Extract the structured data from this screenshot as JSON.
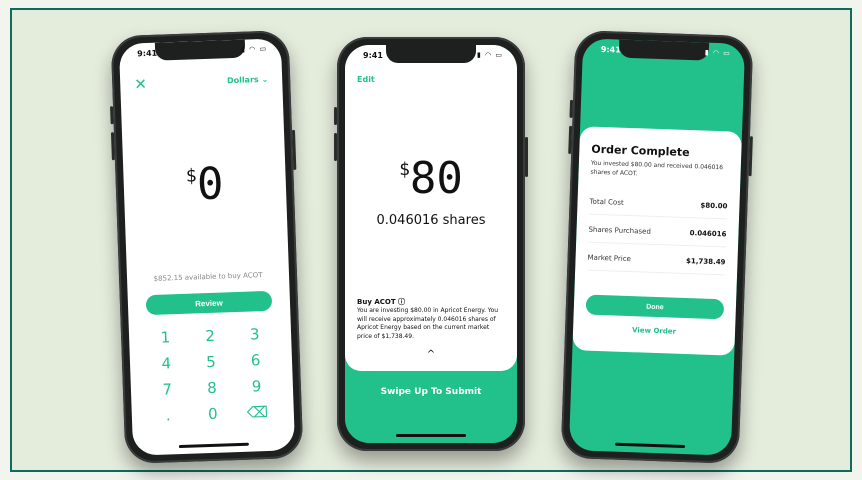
{
  "colors": {
    "accent": "#22c08a",
    "frame_border": "#0f6b60",
    "background": "#e4ecdc"
  },
  "status": {
    "time": "9:41"
  },
  "phone1": {
    "close_icon": "close-icon",
    "currency": "Dollars ⌄",
    "amount_symbol": "$",
    "amount": "0",
    "available": "$852.15 available to buy ACOT",
    "review_label": "Review",
    "keys": [
      "1",
      "2",
      "3",
      "4",
      "5",
      "6",
      "7",
      "8",
      "9",
      ".",
      "0",
      "⌫"
    ]
  },
  "phone2": {
    "edit_label": "Edit",
    "amount_symbol": "$",
    "amount": "80",
    "shares": "0.046016 shares",
    "buy_title": "Buy ACOT ⓘ",
    "buy_desc": "You are investing $80.00 in Apricot Energy. You will receive approximately 0.046016 shares of Apricot Energy based on the current market price of $1,738.49.",
    "chevron": "^",
    "swipe_label": "Swipe Up To Submit"
  },
  "phone3": {
    "title": "Order Complete",
    "subtitle": "You invested $80.00 and received 0.046016 shares of ACOT.",
    "rows": [
      {
        "label": "Total Cost",
        "value": "$80.00"
      },
      {
        "label": "Shares Purchased",
        "value": "0.046016"
      },
      {
        "label": "Market Price",
        "value": "$1,738.49"
      }
    ],
    "done_label": "Done",
    "view_order_label": "View Order"
  }
}
